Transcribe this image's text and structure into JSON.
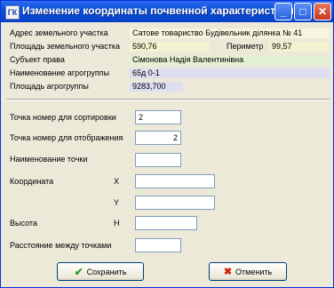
{
  "window": {
    "title": "Изменение координаты почвенной характеристики",
    "icon_glyph": "ГК"
  },
  "titlebar_buttons": {
    "minimize": "_",
    "maximize": "□",
    "close": "✕"
  },
  "info": {
    "address_label": "Адрес земельного участка",
    "address_value": "Сатове товариство  Будівельник  ділянка № 41",
    "area_label": "Площадь земельного участка",
    "area_value": "590,76",
    "perimeter_label": "Периметр",
    "perimeter_value": "99,57",
    "subject_label": "Субъект права",
    "subject_value": "Сімонова Надія Валентинівна",
    "agrogroup_label": "Наименование агрогруппы",
    "agrogroup_value": "65д 0-1",
    "agroarea_label": "Площадь агрогруппы",
    "agroarea_value": "9283,700"
  },
  "colors": {
    "value_bg": "#e9e9a9",
    "value_bg2": "#d9e9b9",
    "value_bg3": "#d9d9f0"
  },
  "form": {
    "sort_label": "Точка номер для сортировки",
    "sort_value": "2",
    "display_label": "Точка номер для отображения",
    "display_value": "2",
    "name_label": "Наименование точки",
    "name_value": "",
    "coord_label": "Координата",
    "x_label": "X",
    "x_value": "",
    "y_label": "Y",
    "y_value": "",
    "height_label": "Высота",
    "h_label": "H",
    "h_value": "",
    "distance_label": "Расстояние между точками",
    "distance_value": ""
  },
  "buttons": {
    "save": "Сохранить",
    "cancel": "Отменить",
    "save_icon": "✔",
    "cancel_icon": "✖"
  }
}
